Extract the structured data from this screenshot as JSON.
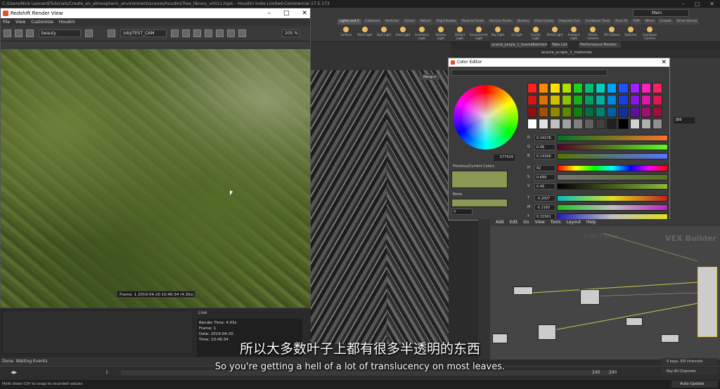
{
  "os_title": "C:/Users/Nick Leonard/Tutorials/Create_an_atmospheric_environment/scenes/houdini/Tree_library_v0011.hiplc - Houdini Indie Limited-Commercial 17.5.173",
  "desktop": "Main",
  "shelf_tabs": [
    "Lights and C",
    "Collisions",
    "Particles",
    "Grains",
    "Vellum",
    "Rigid Bodies",
    "Particle Fluids",
    "Viscous Fluids",
    "Oceans",
    "Fluid Contai",
    "Populate Con",
    "Container Tools",
    "Pyro FX",
    "FEM",
    "Wires",
    "Crowds",
    "Drive Simula"
  ],
  "shelf_buttons": [
    "Camera",
    "Point Light",
    "Spot Light",
    "Area Light",
    "Geometry Light",
    "Volume Light",
    "Distant Light",
    "Environment Light",
    "Sky Light",
    "GI Light",
    "Caustic Light",
    "Portal Light",
    "Ambient Light",
    "Stereo Camera",
    "VR Camera",
    "Switcher",
    "Gamepad Camera"
  ],
  "render_view": {
    "title": "Redshift Render View",
    "menu": [
      "File",
      "View",
      "Customize",
      "Houdini"
    ],
    "aov": "beauty",
    "camera": "/obj/TEST_CAM",
    "zoom": "205 %",
    "frame_overlay": "Frame: 1  2019-04-20  10:46:34  (4.30s)",
    "live_label": "Live",
    "render_info": [
      "Render Time: 4.03s",
      "Frame: 1",
      "Date: 2019-04-20",
      "Time: 10:46:34"
    ],
    "status": "Done. Waiting Events"
  },
  "viewport": {
    "persp": "Persp ▾"
  },
  "pane_tabs": [
    "acacia_jungle_1_leavesBatched",
    "Take List",
    "Performance Monitor"
  ],
  "path": "acacia_jungle_1_materials",
  "color_editor": {
    "title": "Color Editor",
    "hex": "577524",
    "prev_current_label": "Previous/Current Colors",
    "none_label": "None",
    "zero": "0",
    "sliders": [
      {
        "label": "R",
        "value": "0.34378"
      },
      {
        "label": "G",
        "value": "0.46"
      },
      {
        "label": "B",
        "value": "0.14306"
      },
      {
        "label": "H",
        "value": "82"
      },
      {
        "label": "S",
        "value": "0.689"
      },
      {
        "label": "V",
        "value": "0.46"
      },
      {
        "label": "T",
        "value": "-0.2007"
      },
      {
        "label": "M",
        "value": "-0.2165"
      },
      {
        "label": "Y",
        "value": "0.31561"
      }
    ],
    "palette": [
      "#ff2020",
      "#ff8a00",
      "#ffe000",
      "#b0e000",
      "#20d020",
      "#00c070",
      "#00d0c0",
      "#00a0ff",
      "#2050ff",
      "#a020ff",
      "#ff20c0",
      "#ff2060",
      "#d01818",
      "#e07000",
      "#d0c000",
      "#90c000",
      "#18b018",
      "#00a060",
      "#00b0a0",
      "#0088e0",
      "#1840e0",
      "#8818e0",
      "#e018a8",
      "#e01850",
      "#901010",
      "#a05000",
      "#908800",
      "#608800",
      "#108010",
      "#007040",
      "#008070",
      "#0060a0",
      "#1030a0",
      "#6010a0",
      "#a01070",
      "#a01038",
      "#ffffff",
      "#e0e0e0",
      "#c0c0c0",
      "#a0a0a0",
      "#808080",
      "#606060",
      "#404040",
      "#202020",
      "#000000",
      "#d0d0d0",
      "#b0b0b0",
      "#909090"
    ]
  },
  "right_panel": {
    "value": "386"
  },
  "network": {
    "menu": [
      "Add",
      "Edit",
      "Go",
      "View",
      "Tools",
      "Layout",
      "Help"
    ],
    "watermark": "VEX Builder",
    "context": "Indie Edition"
  },
  "timeline": {
    "start": "1",
    "current": "1",
    "end_a": "240",
    "end_b": "240",
    "keys": "0 keys, 0/0 channels",
    "key_all": "Key All Channels"
  },
  "status_bar": "Hold down Ctrl to snap to rounded values",
  "auto_update": "Auto Update",
  "subtitle_zh": "所以大多数叶子上都有很多半透明的东西",
  "subtitle_en": "So you're getting a hell of a lot of translucency on most leaves."
}
